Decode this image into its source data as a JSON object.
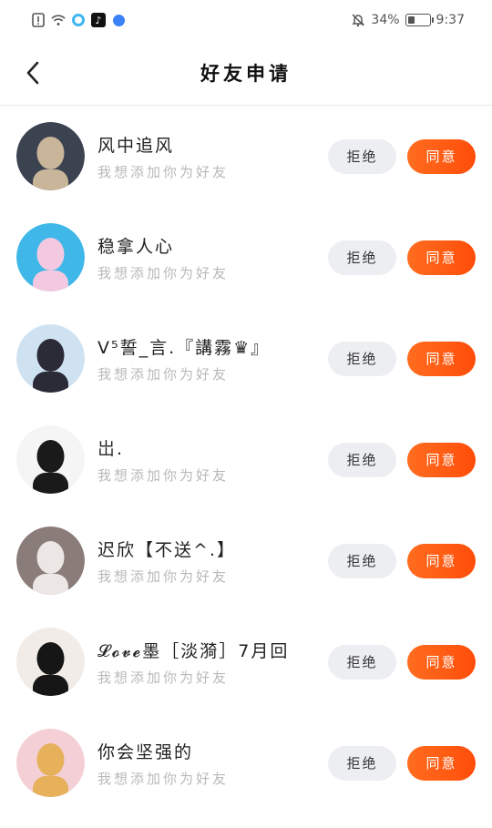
{
  "status_bar": {
    "battery_percent": "34%",
    "battery_level": 0.34,
    "time": "9:37",
    "icons": [
      "alert-icon",
      "wifi-icon",
      "app-ring-icon",
      "tiktok-icon",
      "globe-icon",
      "bell-off-icon",
      "battery-icon"
    ]
  },
  "header": {
    "title": "好友申请",
    "back_icon": "chevron-left-icon"
  },
  "requests": [
    {
      "name": "风中追风",
      "message": "我想添加你为好友",
      "reject_label": "拒绝",
      "accept_label": "同意",
      "avatar_colors": [
        "#3c4350",
        "#c9b59a"
      ]
    },
    {
      "name": "稳拿人心",
      "message": "我想添加你为好友",
      "reject_label": "拒绝",
      "accept_label": "同意",
      "avatar_colors": [
        "#3fb7e8",
        "#f3c9e1"
      ]
    },
    {
      "name": "V⁵誓_言.『講霧♛』",
      "message": "我想添加你为好友",
      "reject_label": "拒绝",
      "accept_label": "同意",
      "avatar_colors": [
        "#cfe2f2",
        "#2b2b38"
      ]
    },
    {
      "name": "岀.",
      "message": "我想添加你为好友",
      "reject_label": "拒绝",
      "accept_label": "同意",
      "avatar_colors": [
        "#f5f5f5",
        "#1a1a1a"
      ]
    },
    {
      "name": "迟欣【不送^.】",
      "message": "我想添加你为好友",
      "reject_label": "拒绝",
      "accept_label": "同意",
      "avatar_colors": [
        "#8a7c78",
        "#ece6e4"
      ]
    },
    {
      "name": "𝓛𝓸𝓿𝓮墨［淡漪］7月回",
      "message": "我想添加你为好友",
      "reject_label": "拒绝",
      "accept_label": "同意",
      "avatar_colors": [
        "#f1ece7",
        "#161616"
      ]
    },
    {
      "name": "你会坚强的",
      "message": "我想添加你为好友",
      "reject_label": "拒绝",
      "accept_label": "同意",
      "avatar_colors": [
        "#f4cfd6",
        "#e6b15a"
      ]
    }
  ],
  "colors": {
    "accent": "#ff5a14",
    "reject_bg": "#eceef2",
    "message_text": "#b9b9b9"
  }
}
